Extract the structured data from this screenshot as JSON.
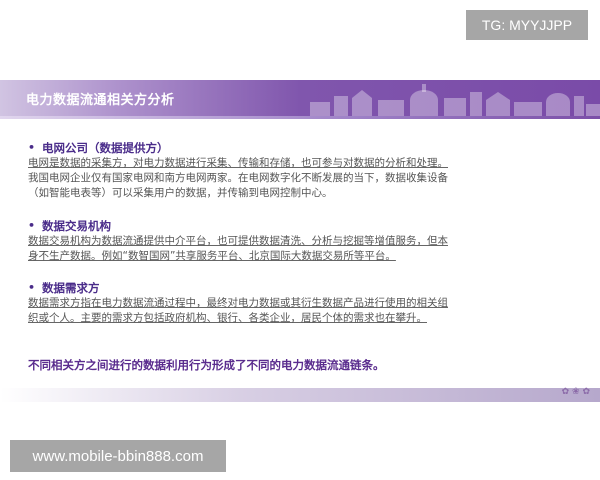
{
  "watermarks": {
    "top": "TG: MYYJJPP",
    "bottom": "www.mobile-bbin888.com"
  },
  "slide": {
    "title": "电力数据流通相关方分析",
    "sections": [
      {
        "heading": "电网公司（数据提供方）",
        "lines": [
          "电网是数据的采集方，对电力数据进行采集、传输和存储，也可参与对数据的分析和处理。",
          "我国电网企业仅有国家电网和南方电网两家。在电网数字化不断发展的当下，数据收集设备",
          "（如智能电表等）可以采集用户的数据，并传输到电网控制中心。"
        ]
      },
      {
        "heading": "数据交易机构",
        "lines": [
          "数据交易机构为数据流通提供中介平台，也可提供数据清洗、分析与挖掘等增值服务，但本",
          "身不生产数据。例如“数智国网”共享服务平台、北京国际大数据交易所等平台。"
        ]
      },
      {
        "heading": "数据需求方",
        "lines": [
          "数据需求方指在电力数据流通过程中，最终对电力数据或其衍生数据产品进行使用的相关组",
          "织或个人。主要的需求方包括政府机构、银行、各类企业，居民个体的需求也在攀升。"
        ]
      }
    ],
    "conclusion": "不同相关方之间进行的数据利用行为形成了不同的电力数据流通链条。"
  },
  "colors": {
    "header_purple": "#7a4ba8",
    "heading_text": "#4a2c8a",
    "body_text": "#555555"
  }
}
